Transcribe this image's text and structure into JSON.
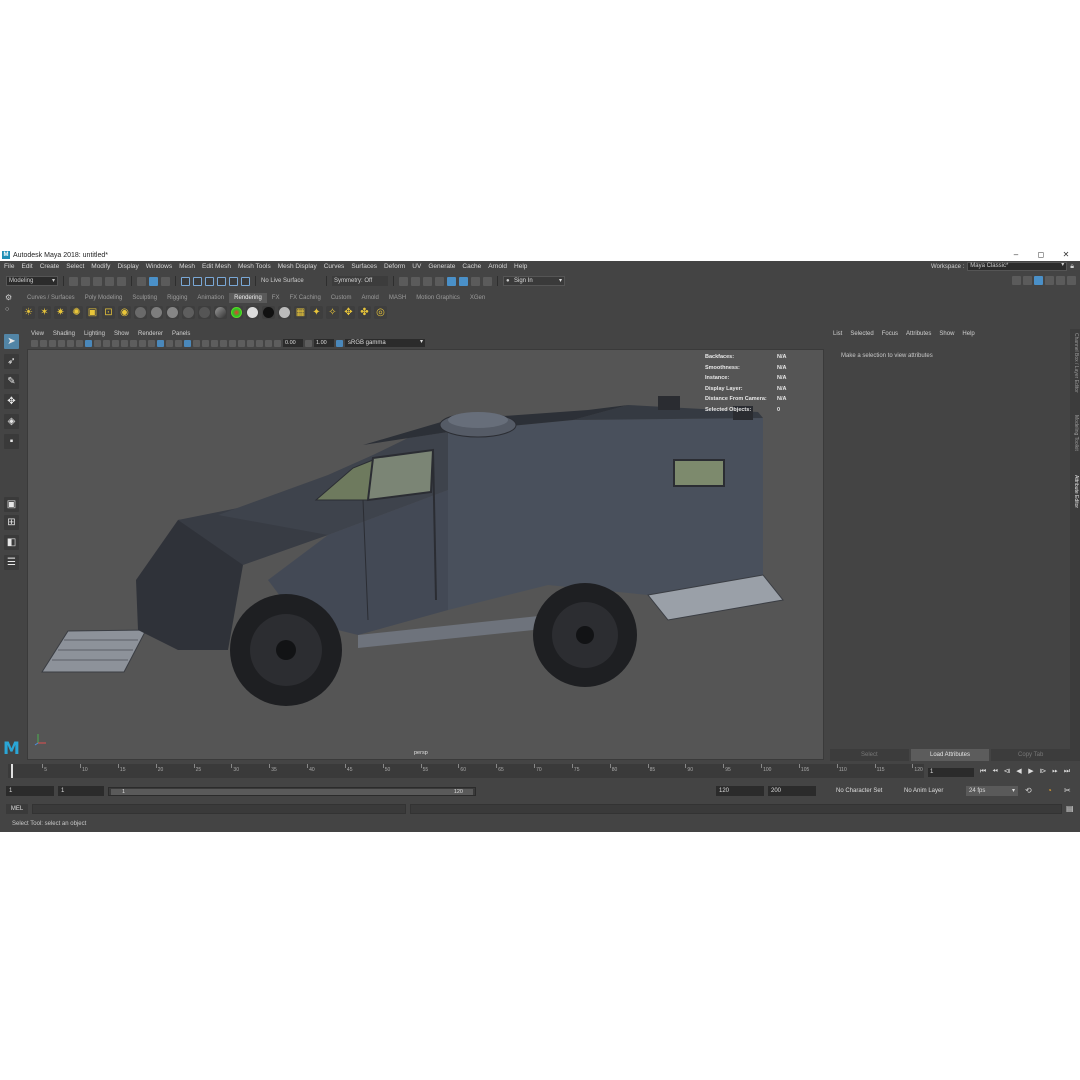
{
  "window": {
    "title": "Autodesk Maya 2018: untitled*",
    "logo": "M"
  },
  "menus": [
    "File",
    "Edit",
    "Create",
    "Select",
    "Modify",
    "Display",
    "Windows",
    "Mesh",
    "Edit Mesh",
    "Mesh Tools",
    "Mesh Display",
    "Curves",
    "Surfaces",
    "Deform",
    "UV",
    "Generate",
    "Cache",
    "Arnold",
    "Help"
  ],
  "workspace": {
    "label": "Workspace :",
    "value": "Maya Classic*"
  },
  "statusline": {
    "mode": "Modeling",
    "live_surface": "No Live Surface",
    "symmetry": "Symmetry: Off",
    "sign_in": "Sign In"
  },
  "shelf": {
    "tabs": [
      "Curves / Surfaces",
      "Poly Modeling",
      "Sculpting",
      "Rigging",
      "Animation",
      "Rendering",
      "FX",
      "FX Caching",
      "Custom",
      "Arnold",
      "MASH",
      "Motion Graphics",
      "XGen"
    ],
    "active_tab": "Rendering"
  },
  "viewport": {
    "menu": [
      "View",
      "Shading",
      "Lighting",
      "Show",
      "Renderer",
      "Panels"
    ],
    "exposure": "0.00",
    "gamma_value": "1.00",
    "color_space": "sRGB gamma",
    "camera": "persp",
    "hud": [
      {
        "label": "Backfaces:",
        "value": "N/A"
      },
      {
        "label": "Smoothness:",
        "value": "N/A"
      },
      {
        "label": "Instance:",
        "value": "N/A"
      },
      {
        "label": "Display Layer:",
        "value": "N/A"
      },
      {
        "label": "Distance From Camera:",
        "value": "N/A"
      },
      {
        "label": "Selected Objects:",
        "value": "0"
      }
    ]
  },
  "attribute_editor": {
    "menu": [
      "List",
      "Selected",
      "Focus",
      "Attributes",
      "Show",
      "Help"
    ],
    "message": "Make a selection to view attributes",
    "buttons": {
      "select": "Select",
      "load": "Load Attributes",
      "copy": "Copy Tab"
    },
    "side_tabs": [
      "Channel Box / Layer Editor",
      "Modeling Toolkit",
      "Attribute Editor"
    ]
  },
  "timeline": {
    "ticks": [
      "5",
      "10",
      "15",
      "20",
      "25",
      "30",
      "35",
      "40",
      "45",
      "50",
      "55",
      "60",
      "65",
      "70",
      "75",
      "80",
      "85",
      "90",
      "95",
      "100",
      "105",
      "110",
      "115",
      "120"
    ],
    "current_frame": "1",
    "range_start": "1",
    "range_start_inner": "1",
    "range_slider_start": "1",
    "range_slider_end": "120",
    "range_end": "120",
    "playback_end": "200",
    "character_set": "No Character Set",
    "anim_layer": "No Anim Layer",
    "fps": "24 fps"
  },
  "command": {
    "mel_label": "MEL",
    "help_line": "Select Tool: select an object"
  },
  "colors": {
    "accent": "#5285a6",
    "maya_blue": "#2aa6d6",
    "panel": "#444444",
    "viewport": "#555555"
  }
}
